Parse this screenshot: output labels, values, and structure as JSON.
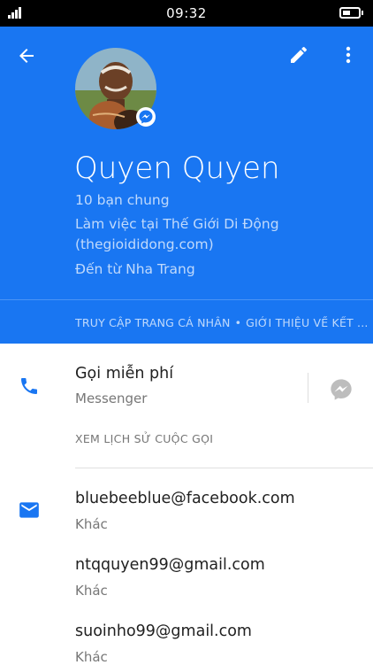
{
  "status_bar": {
    "time": "09:32"
  },
  "header": {
    "name": "Quyen Quyen",
    "mutual_friends": "10 bạn chung",
    "work_line1": "Làm việc tại Thế Giới Di Động",
    "work_line2": "(thegioididong.com)",
    "from": "Đến từ Nha Trang",
    "link_profile": "TRUY CẬP TRANG CÁ NHÂN",
    "link_separator": "•",
    "link_about": "GIỚI THIỆU VỀ KẾT ..."
  },
  "call": {
    "title": "Gọi miễn phí",
    "subtitle": "Messenger",
    "history_link": "XEM LỊCH SỬ CUỘC GỌI"
  },
  "emails": [
    {
      "address": "bluebeeblue@facebook.com",
      "type": "Khác"
    },
    {
      "address": "ntqquyen99@gmail.com",
      "type": "Khác"
    },
    {
      "address": "suoinho99@gmail.com",
      "type": "Khác"
    }
  ],
  "colors": {
    "header_blue": "#1976f2",
    "icon_blue": "#1976f2",
    "gray_icon": "#bdbdbd"
  },
  "icons": {
    "back": "arrow-left",
    "edit": "pencil",
    "more": "vertical-dots",
    "phone": "phone",
    "mail": "envelope",
    "messenger": "messenger-bolt"
  }
}
